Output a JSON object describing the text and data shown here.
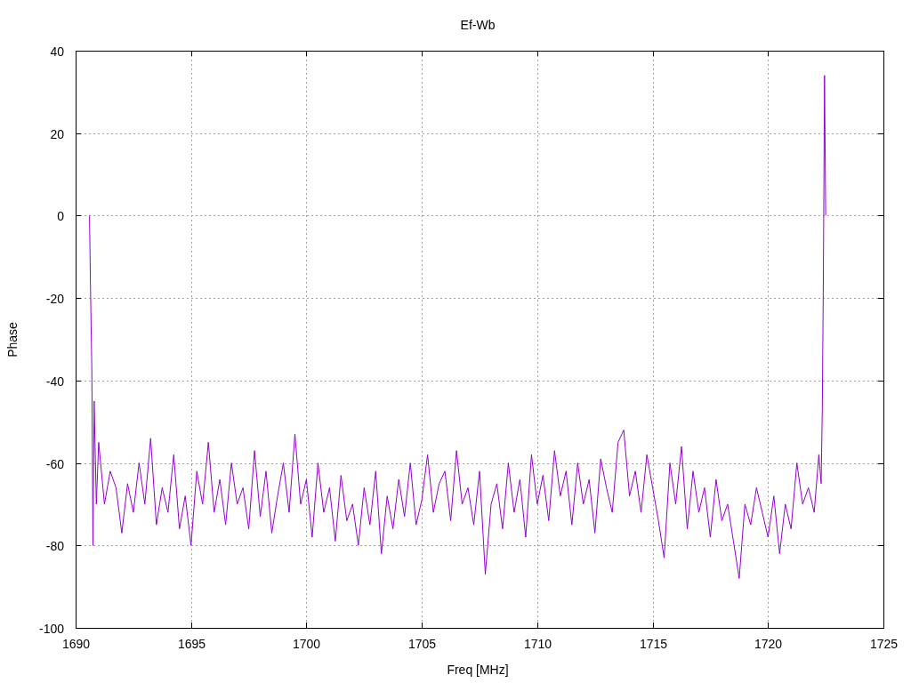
{
  "chart_data": {
    "type": "line",
    "grid": true,
    "title": "Ef-Wb",
    "xlabel": "Freq [MHz]",
    "ylabel": "Phase",
    "xlim": [
      1690,
      1725
    ],
    "ylim": [
      -100,
      40
    ],
    "xticks": [
      1690,
      1695,
      1700,
      1705,
      1710,
      1715,
      1720,
      1725
    ],
    "yticks": [
      -100,
      -80,
      -60,
      -40,
      -20,
      0,
      20,
      40
    ],
    "x": [
      1690.6,
      1690.65,
      1690.7,
      1690.75,
      1690.8,
      1690.9,
      1691,
      1691.25,
      1691.5,
      1691.75,
      1692,
      1692.25,
      1692.5,
      1692.75,
      1693,
      1693.25,
      1693.5,
      1693.75,
      1694,
      1694.25,
      1694.5,
      1694.75,
      1695,
      1695.25,
      1695.5,
      1695.75,
      1696,
      1696.25,
      1696.5,
      1696.75,
      1697,
      1697.25,
      1697.5,
      1697.75,
      1698,
      1698.25,
      1698.5,
      1698.75,
      1699,
      1699.25,
      1699.5,
      1699.75,
      1700,
      1700.25,
      1700.5,
      1700.75,
      1701,
      1701.25,
      1701.5,
      1701.75,
      1702,
      1702.25,
      1702.5,
      1702.75,
      1703,
      1703.25,
      1703.5,
      1703.75,
      1704,
      1704.25,
      1704.5,
      1704.75,
      1705,
      1705.25,
      1705.5,
      1705.75,
      1706,
      1706.25,
      1706.5,
      1706.75,
      1707,
      1707.25,
      1707.5,
      1707.75,
      1708,
      1708.25,
      1708.5,
      1708.75,
      1709,
      1709.25,
      1709.5,
      1709.75,
      1710,
      1710.25,
      1710.5,
      1710.75,
      1711,
      1711.25,
      1711.5,
      1711.75,
      1712,
      1712.25,
      1712.5,
      1712.75,
      1713,
      1713.25,
      1713.5,
      1713.75,
      1714,
      1714.25,
      1714.5,
      1714.75,
      1715,
      1715.25,
      1715.5,
      1715.75,
      1716,
      1716.25,
      1716.5,
      1716.75,
      1717,
      1717.25,
      1717.5,
      1717.75,
      1718,
      1718.25,
      1718.5,
      1718.75,
      1719,
      1719.25,
      1719.5,
      1719.75,
      1720,
      1720.25,
      1720.5,
      1720.75,
      1721,
      1721.25,
      1721.5,
      1721.75,
      1722,
      1722.2,
      1722.3,
      1722.35,
      1722.4,
      1722.45,
      1722.5
    ],
    "series": [
      {
        "color": "#9400d3",
        "values": [
          0,
          -20,
          -37,
          -80,
          -45,
          -70,
          -55,
          -70,
          -62,
          -66,
          -77,
          -65,
          -72,
          -60,
          -70,
          -54,
          -75,
          -66,
          -72,
          -58,
          -76,
          -68,
          -80,
          -62,
          -70,
          -55,
          -72,
          -64,
          -75,
          -60,
          -70,
          -66,
          -76,
          -57,
          -73,
          -62,
          -77,
          -68,
          -60,
          -72,
          -53,
          -70,
          -64,
          -78,
          -60,
          -72,
          -66,
          -79,
          -63,
          -74,
          -70,
          -80,
          -66,
          -75,
          -62,
          -82,
          -68,
          -76,
          -64,
          -73,
          -60,
          -75,
          -69,
          -58,
          -72,
          -65,
          -62,
          -74,
          -57,
          -70,
          -66,
          -75,
          -62,
          -87,
          -70,
          -65,
          -76,
          -60,
          -72,
          -64,
          -78,
          -58,
          -70,
          -63,
          -74,
          -57,
          -68,
          -62,
          -75,
          -60,
          -70,
          -64,
          -77,
          -59,
          -66,
          -72,
          -55,
          -52,
          -68,
          -62,
          -72,
          -58,
          -66,
          -74,
          -83,
          -60,
          -70,
          -56,
          -76,
          -62,
          -72,
          -66,
          -78,
          -64,
          -74,
          -70,
          -79,
          -88,
          -70,
          -75,
          -66,
          -72,
          -78,
          -68,
          -82,
          -70,
          -76,
          -60,
          -70,
          -66,
          -72,
          -58,
          -65,
          -47,
          -15,
          34,
          0
        ]
      }
    ]
  }
}
